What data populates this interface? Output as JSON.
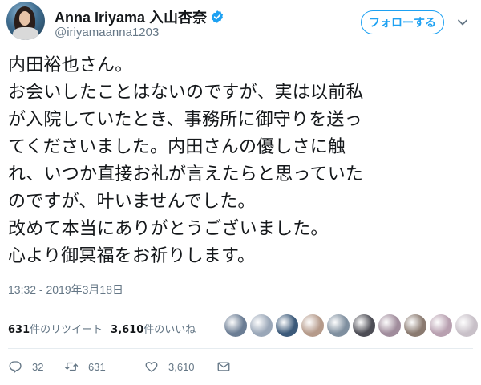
{
  "user": {
    "display_name": "Anna Iriyama 入山杏奈",
    "handle": "@iriyamaanna1203",
    "verified": true,
    "follow_label": "フォローする"
  },
  "tweet": {
    "lines": [
      "内田裕也さん。",
      "お会いしたことはないのですが、実は以前私",
      "が入院していたとき、事務所に御守りを送っ",
      "てくださいました。内田さんの優しさに触",
      "れ、いつか直接お礼が言えたらと思っていた",
      "のですが、叶いませんでした。",
      "改めて本当にありがとうございました。",
      "心より御冥福をお祈りします。"
    ],
    "timestamp": "13:32 - 2019年3月18日"
  },
  "stats": {
    "retweets_count": "631",
    "retweets_label": "件のリツイート",
    "likes_count": "3,610",
    "likes_label": "件のいいね"
  },
  "likers": [
    "#6b7d94",
    "#9aa7b8",
    "#3c5a7a",
    "#b59a8a",
    "#7f8f9f",
    "#4d4d55",
    "#a08c9c",
    "#8a7a70",
    "#b8a0b0",
    "#c8c0c8"
  ],
  "actions": {
    "reply_count": "32",
    "retweet_count": "631",
    "like_count": "3,610"
  },
  "colors": {
    "accent": "#1da1f2",
    "secondary_text": "#657786"
  }
}
